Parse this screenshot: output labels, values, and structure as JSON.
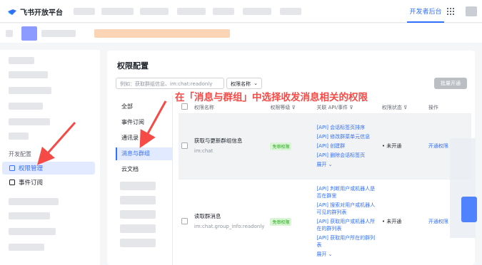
{
  "topbar": {
    "logo_text": "飞书开放平台",
    "dev_console_label": "开发者后台"
  },
  "sidebar": {
    "section_label": "开发配置",
    "items": [
      {
        "label": "权限管理",
        "icon": "permission-icon",
        "active": true
      },
      {
        "label": "事件订阅",
        "icon": "event-icon",
        "active": false
      }
    ]
  },
  "main": {
    "title": "权限配置",
    "search_placeholder": "例如：获取群组信息、im:chat:readonly",
    "select_value": "权限名称",
    "batch_button": "批量开通",
    "categories": [
      "全部",
      "事件订阅",
      "通讯录",
      "消息与群组",
      "云文档"
    ],
    "active_category": "消息与群组",
    "table": {
      "headers": [
        "权限名称",
        "权限等级",
        "关联 API/事件",
        "权限状态",
        "操作"
      ],
      "rows": [
        {
          "name": "获取与更新群组信息",
          "code": "im:chat",
          "level": "免审权限",
          "apis": [
            "[API] 会话标签页排序",
            "[API] 修改群菜单元信息",
            "[API] 创建群",
            "[API] 删除会话标签页"
          ],
          "expand": "展开",
          "status": "未开通",
          "action": "开通权限"
        },
        {
          "name": "读取群消息",
          "code": "im:chat.group_info:readonly",
          "level": "免审权限",
          "apis": [
            "[API] 判断用户或机器人是否在群里",
            "[API] 搜索对用户或机器人可见的群列表",
            "[API] 获取用户或机器人所在的群列表",
            "[API] 获取用户所在的群列表"
          ],
          "expand": "展开",
          "status": "未开通",
          "action": "开通权限"
        }
      ]
    }
  },
  "annotation": "在「消息与群组」中选择收发消息相关的权限",
  "colors": {
    "accent": "#3370ff",
    "annotation": "#f54a45",
    "tag_bg": "#d9f5d6",
    "tag_text": "#2ea121"
  }
}
